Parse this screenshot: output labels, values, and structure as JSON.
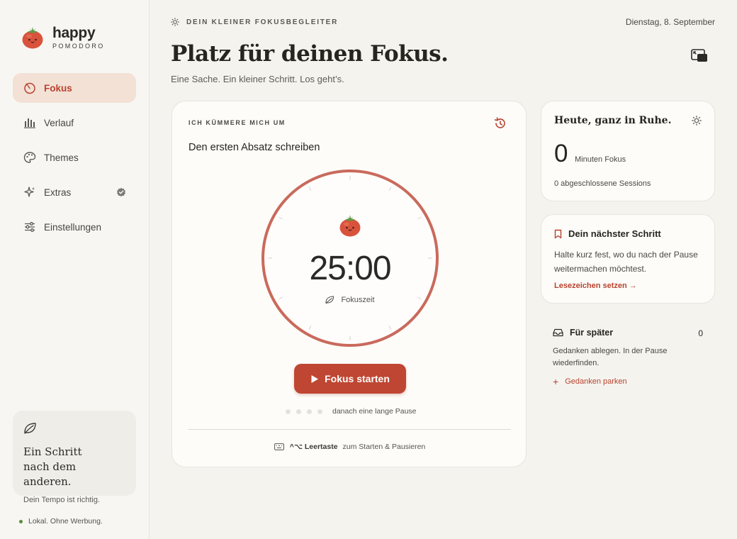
{
  "brand": {
    "name": "happy",
    "subtitle": "POMODORO"
  },
  "nav": {
    "items": [
      {
        "label": "Fokus",
        "icon": "timer-icon",
        "active": true
      },
      {
        "label": "Verlauf",
        "icon": "bar-chart-icon"
      },
      {
        "label": "Themes",
        "icon": "palette-icon"
      },
      {
        "label": "Extras",
        "icon": "sparkle-icon",
        "badge": "verified-badge-icon"
      },
      {
        "label": "Einstellungen",
        "icon": "sliders-icon"
      }
    ]
  },
  "sidebar_quote": {
    "icon": "leaf-icon",
    "title_line1": "Ein Schritt",
    "title_line2": "nach dem anderen.",
    "subtitle": "Dein Tempo ist richtig."
  },
  "footer": {
    "note": "Lokal. Ohne Werbung."
  },
  "header": {
    "eyebrow": "DEIN KLEINER FOKUSBEGLEITER",
    "date": "Dienstag, 8. September",
    "title": "Platz für deinen Fokus.",
    "subtitle": "Eine Sache. Ein kleiner Schritt. Los geht’s."
  },
  "focus_card": {
    "task_label": "ICH KÜMMERE MICH UM",
    "task_title": "Den ersten Absatz schreiben",
    "timer": {
      "time": "25:00",
      "mode": "Fokuszeit",
      "progress": 0
    },
    "start_label": "Fokus starten",
    "sessions": {
      "total": 4,
      "completed": 0,
      "text": "danach eine lange Pause"
    },
    "shortcut": {
      "keys": "^⌥ Leertaste",
      "text": "zum Starten & Pausieren"
    }
  },
  "today": {
    "title": "Heute, ganz in Ruhe.",
    "minutes": "0",
    "minutes_unit": "Minuten Fokus",
    "sessions": "0 abgeschlossene Sessions"
  },
  "next_step": {
    "title": "Dein nächster Schritt",
    "body": "Halte kurz fest, wo du nach der Pause weitermachen möchtest.",
    "link": "Lesezeichen setzen →"
  },
  "later": {
    "title": "Für später",
    "count": "0",
    "body": "Gedanken ablegen. In der Pause wiederfinden.",
    "link": "Gedanken parken"
  },
  "colors": {
    "accent": "#bf4632",
    "ring": "#c96a5c",
    "active_nav_bg": "#f3e1d6",
    "background": "#f5f3ee",
    "card": "#fdfcf9"
  }
}
